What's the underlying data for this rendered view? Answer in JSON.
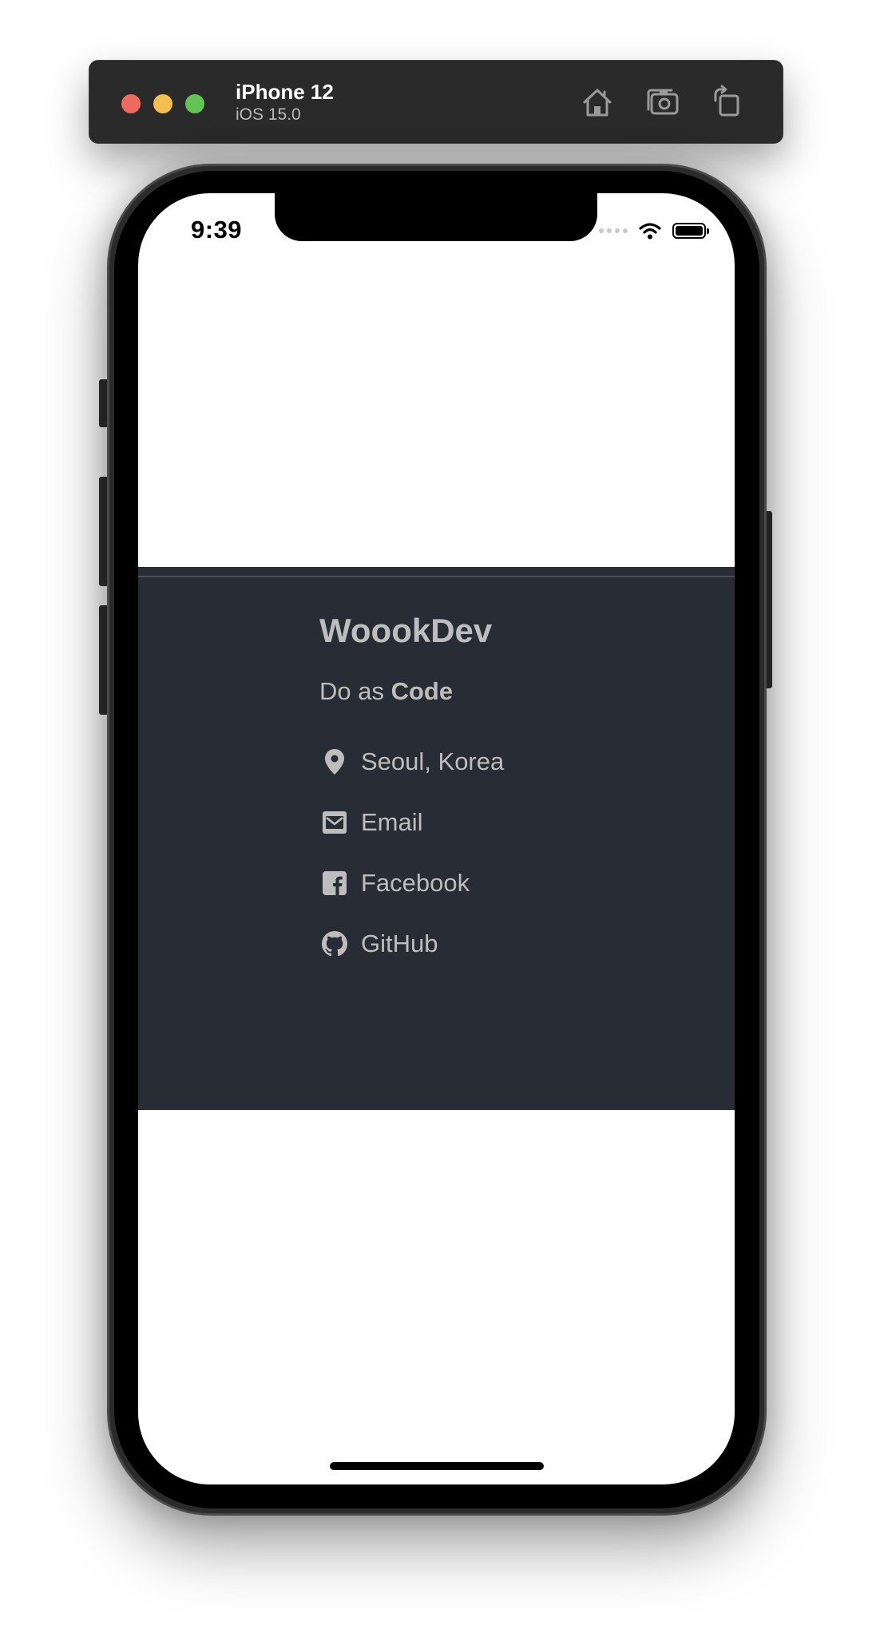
{
  "simulator": {
    "device_name": "iPhone 12",
    "os_version": "iOS 15.0",
    "toolbar_icons": [
      "home-icon",
      "screenshot-icon",
      "rotate-icon"
    ]
  },
  "status_bar": {
    "time": "9:39",
    "icons": [
      "signal-icon",
      "wifi-icon",
      "battery-icon"
    ]
  },
  "footer": {
    "background": "#282c34",
    "text_color": "#bdbdbd",
    "brand": "WoookDev",
    "tagline_prefix": "Do as ",
    "tagline_bold": "Code",
    "contacts": [
      {
        "icon": "location-pin-icon",
        "label": "Seoul, Korea"
      },
      {
        "icon": "envelope-icon",
        "label": "Email"
      },
      {
        "icon": "facebook-icon",
        "label": "Facebook"
      },
      {
        "icon": "github-icon",
        "label": "GitHub"
      }
    ]
  }
}
